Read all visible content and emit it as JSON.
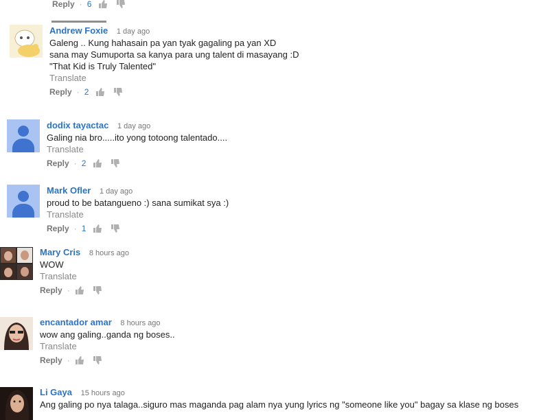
{
  "colors": {
    "author_link": "#2a73c6",
    "meta_gray": "#777777",
    "icon_gray": "#b0b0b0",
    "default_avatar_bg": "#a9c4f2",
    "default_avatar_fg": "#3f73cf"
  },
  "ui": {
    "reply_label": "Reply",
    "translate_label": "Translate",
    "like_icon": "thumbs-up-icon",
    "dislike_icon": "thumbs-down-icon"
  },
  "top_partial": {
    "reply_label": "Reply",
    "like_count": "6"
  },
  "comments": [
    {
      "author": "Andrew Foxie",
      "time": "1 day ago",
      "lines": [
        "Galeng .. Kung hahasain pa yan tyak gagaling pa yan XD",
        "sana may Sumuporta sa kanya para ung talent di masayang :D",
        "\"That Kid is Truly Talented\""
      ],
      "translate": "Translate",
      "reply": "Reply",
      "likes": "2"
    },
    {
      "author": "dodix tayactac",
      "time": "1 day ago",
      "lines": [
        "Galing nia bro.....ito yong totoong talentado...."
      ],
      "translate": "Translate",
      "reply": "Reply",
      "likes": "2"
    },
    {
      "author": "Mark Ofler",
      "time": "1 day ago",
      "lines": [
        "proud to be batangueno :) sana sumikat sya :)"
      ],
      "translate": "Translate",
      "reply": "Reply",
      "likes": "1"
    },
    {
      "author": "Mary Cris",
      "time": "8 hours ago",
      "lines": [
        "WOW"
      ],
      "translate": "Translate",
      "reply": "Reply",
      "likes": ""
    },
    {
      "author": "encantador amar",
      "time": "8 hours ago",
      "lines": [
        "wow ang galing..ganda ng boses.."
      ],
      "translate": "Translate",
      "reply": "Reply",
      "likes": ""
    },
    {
      "author": "Li Gaya",
      "time": "15 hours ago",
      "lines": [
        "Ang galing po nya talaga..siguro mas maganda pag alam nya yung lyrics ng \"someone like you\" bagay sa klase ng boses"
      ],
      "translate": "",
      "reply": "",
      "likes": ""
    }
  ]
}
